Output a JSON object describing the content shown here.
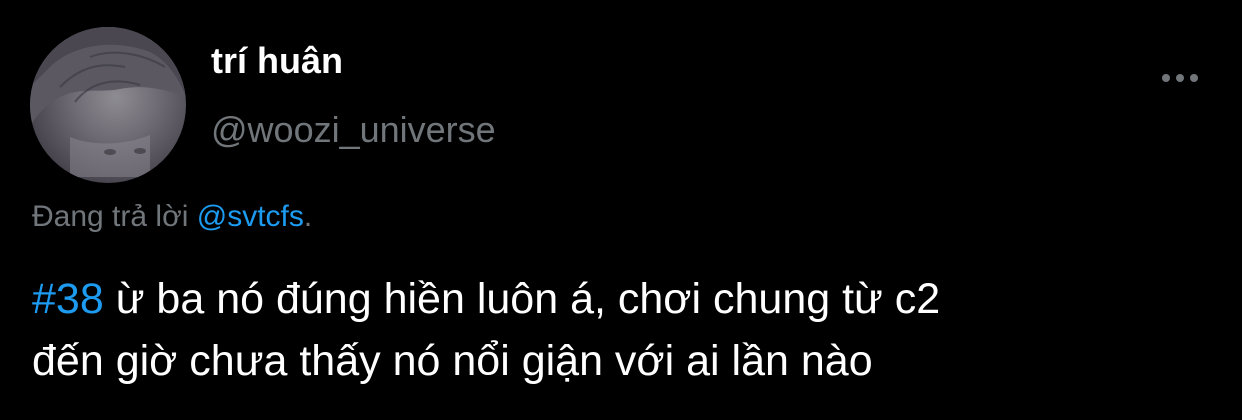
{
  "tweet": {
    "author": {
      "display_name": "trí huân",
      "handle": "@woozi_universe",
      "avatar_icon": "user-avatar"
    },
    "more_icon": "more-horizontal-icon",
    "reply_context": {
      "prefix": "Đang trả lời ",
      "mention": "@svtcfs",
      "suffix": "."
    },
    "text": {
      "hashtag": "#38",
      "line1": " ừ ba nó đúng hiền luôn á, chơi chung từ c2",
      "line2": "đến giờ chưa thấy nó nổi giận với ai lần nào"
    }
  },
  "colors": {
    "background": "#000000",
    "primary_text": "#ffffff",
    "secondary_text": "#71767b",
    "accent": "#1d9bf0"
  }
}
